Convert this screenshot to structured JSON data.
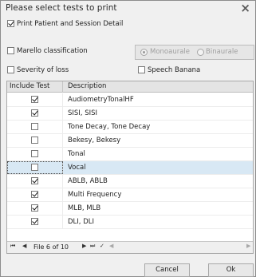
{
  "dialog": {
    "title": "Please select tests to print",
    "close_glyph": "×"
  },
  "options": {
    "print_patient_detail": {
      "label": "Print Patient and Session Detail",
      "checked": true
    },
    "marello": {
      "label": "Marello classification",
      "checked": false
    },
    "radio_monoaurale": {
      "label": "Monoaurale",
      "selected": true
    },
    "radio_binaurale": {
      "label": "Binaurale",
      "selected": false
    },
    "severity": {
      "label": "Severity of loss",
      "checked": false
    },
    "speech_banana": {
      "label": "Speech Banana",
      "checked": false
    }
  },
  "grid": {
    "columns": [
      "Include Test",
      "Description"
    ],
    "rows": [
      {
        "include": true,
        "description": "AudiometryTonalHF"
      },
      {
        "include": true,
        "description": "SISI, SISI"
      },
      {
        "include": false,
        "description": "Tone Decay, Tone Decay"
      },
      {
        "include": false,
        "description": "Bekesy, Bekesy"
      },
      {
        "include": false,
        "description": "Tonal"
      },
      {
        "include": false,
        "description": "Vocal",
        "selected": true
      },
      {
        "include": true,
        "description": "ABLB, ABLB"
      },
      {
        "include": true,
        "description": "Multi Frequency"
      },
      {
        "include": true,
        "description": "MLB, MLB"
      },
      {
        "include": true,
        "description": "DLI, DLI"
      }
    ]
  },
  "navigator": {
    "first": "⏮",
    "prev": "◀",
    "status": "File 6 of 10",
    "next": "▶",
    "last": "⏭",
    "confirm": "✓",
    "scroll_left": "◀",
    "scroll_right": "▶"
  },
  "buttons": {
    "cancel": "Cancel",
    "ok": "Ok"
  },
  "colors": {
    "selected_row": "#d8e8f4",
    "dialog_bg": "#f0f0f0"
  }
}
